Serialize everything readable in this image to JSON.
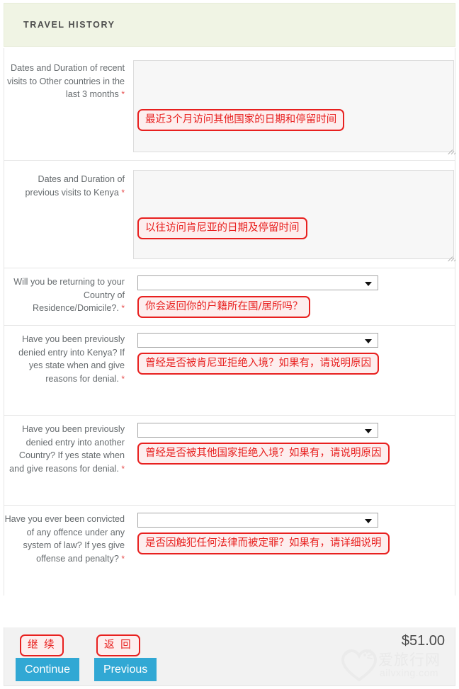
{
  "section": {
    "title": "TRAVEL HISTORY",
    "header_bg": "#f0f4e4"
  },
  "accent": {
    "annotation_red": "#e8201f",
    "annotation_fill": "#fdeeee",
    "button_blue": "#31a8d4",
    "required_red": "#e74c4c"
  },
  "fields": [
    {
      "label": "Dates and Duration of recent visits to Other countries in the last 3 months",
      "required_mark": "*",
      "control": "textarea",
      "value": "",
      "annotation": "最近3个月访问其他国家的日期和停留时间"
    },
    {
      "label": "Dates and Duration of previous visits to Kenya",
      "required_mark": "*",
      "control": "textarea",
      "value": "",
      "annotation": "以往访问肯尼亚的日期及停留时间"
    },
    {
      "label": "Will you be returning to your Country of Residence/Domicile?.",
      "required_mark": "*",
      "control": "select",
      "value": "",
      "annotation": "你会返回你的户籍所在国/居所吗？"
    },
    {
      "label": "Have you been previously denied entry into Kenya? If yes state when and give reasons for denial.",
      "required_mark": "*",
      "control": "select",
      "value": "",
      "annotation": "曾经是否被肯尼亚拒绝入境？如果有，请说明原因"
    },
    {
      "label": "Have you been previously denied entry into another Country? If yes state when and give reasons for denial.",
      "required_mark": "*",
      "control": "select",
      "value": "",
      "annotation": "曾经是否被其他国家拒绝入境？如果有，请说明原因"
    },
    {
      "label": "Have you ever been convicted of any offence under any system of law? If yes give offense and penalty?",
      "required_mark": "*",
      "control": "select",
      "value": "",
      "annotation": "是否因触犯任何法律而被定罪？如果有，请详细说明"
    }
  ],
  "footer": {
    "price": "$51.00",
    "continue_label": "Continue",
    "previous_label": "Previous",
    "continue_annotation": "继 续",
    "previous_annotation": "返 回"
  },
  "watermark": {
    "brand": "爱旅行网",
    "domain": "ailvxing.com",
    "logo_icon": "heart-logo-icon"
  }
}
